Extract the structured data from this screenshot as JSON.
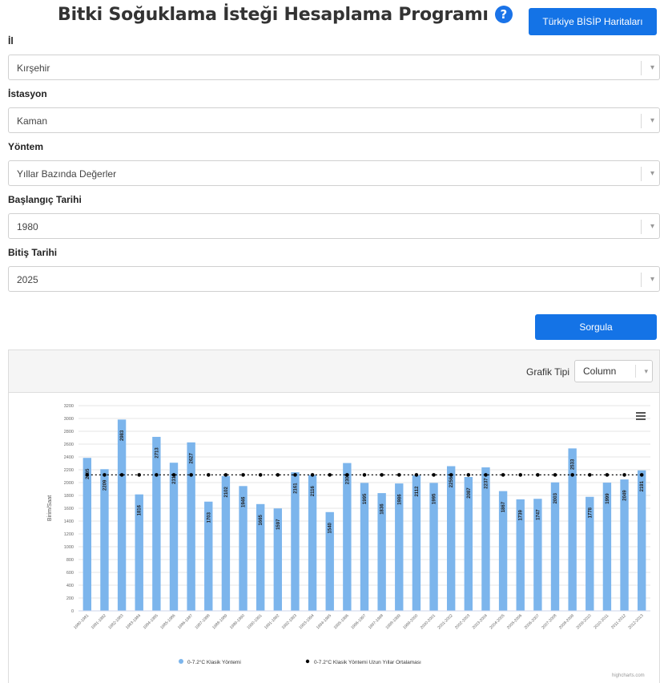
{
  "page": {
    "title": "Bitki Soğuklama İsteği Hesaplama Programı",
    "map_button": "Türkiye BİSİP Haritaları"
  },
  "form": {
    "il_label": "İl",
    "il_value": "Kırşehir",
    "istasyon_label": "İstasyon",
    "istasyon_value": "Kaman",
    "yontem_label": "Yöntem",
    "yontem_value": "Yıllar Bazında Değerler",
    "baslangic_label": "Başlangıç Tarihi",
    "baslangic_value": "1980",
    "bitis_label": "Bitiş Tarihi",
    "bitis_value": "2025",
    "query_button": "Sorgula"
  },
  "chart_panel": {
    "type_label": "Grafik Tipi",
    "type_value": "Column",
    "credits": "highcharts.com"
  },
  "colors": {
    "accent": "#1473e6",
    "bar": "#7cb5ec",
    "average_line": "#000000"
  },
  "chart_data": {
    "type": "bar",
    "ylabel": "Birim/Saat",
    "ylim": [
      0,
      3200
    ],
    "ytick_step": 200,
    "categories": [
      "1980-1981",
      "1981-1982",
      "1982-1983",
      "1983-1984",
      "1984-1985",
      "1985-1986",
      "1986-1987",
      "1987-1988",
      "1988-1989",
      "1989-1990",
      "1990-1991",
      "1991-1992",
      "1992-1993",
      "1993-1994",
      "1994-1995",
      "1995-1996",
      "1996-1997",
      "1997-1998",
      "1998-1999",
      "1999-2000",
      "2000-2001",
      "2001-2002",
      "2002-2003",
      "2003-2004",
      "2004-2005",
      "2005-2006",
      "2006-2007",
      "2007-2008",
      "2008-2009",
      "2009-2010",
      "2010-2011",
      "2011-2012",
      "2012-2013",
      "2013-2014",
      "2014-2015"
    ],
    "series": [
      {
        "name": "0-7.2°C Klasik Yöntemi",
        "values": [
          2385,
          2209,
          2983,
          1816,
          2713,
          2310,
          2627,
          1703,
          2102,
          1946,
          1665,
          1597,
          2161,
          2116,
          1540,
          2305,
          1995,
          1836,
          1986,
          2112,
          1995,
          2256,
          2087,
          2237,
          1867,
          1739,
          1747,
          2003,
          2533,
          1778,
          1999,
          2049,
          2191
        ]
      },
      {
        "name": "0-7.2°C Klasik Yöntemi Uzun Yıllar Ortalaması",
        "values": [
          2120,
          2120,
          2120,
          2120,
          2120,
          2120,
          2120,
          2120,
          2120,
          2120,
          2120,
          2120,
          2120,
          2120,
          2120,
          2120,
          2120,
          2120,
          2120,
          2120,
          2120,
          2120,
          2120,
          2120,
          2120,
          2120,
          2120,
          2120,
          2120,
          2120,
          2120,
          2120,
          2120
        ]
      }
    ],
    "legend_position": "bottom-center"
  }
}
